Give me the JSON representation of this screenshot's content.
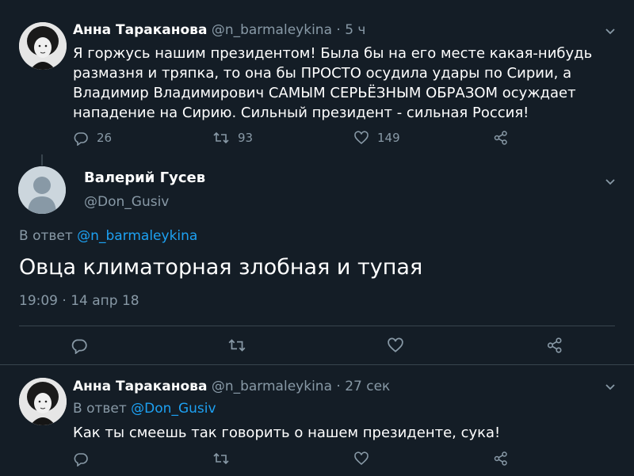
{
  "tweet1": {
    "author_name": "Анна Тараканова",
    "author_handle": "@n_barmaleykina",
    "time": "· 5 ч",
    "text": "Я горжусь нашим президентом! Была бы на его месте какая-нибудь размазня и тряпка, то она бы ПРОСТО осудила удары по Сирии, а Владимир Владимирович САМЫМ СЕРЬЁЗНЫМ ОБРАЗОМ осуждает нападение на Сирию. Сильный президент - сильная Россия!",
    "replies": "26",
    "retweets": "93",
    "likes": "149"
  },
  "tweet2": {
    "author_name": "Валерий Гусев",
    "author_handle": "@Don_Gusiv",
    "reply_prefix": "В ответ",
    "reply_mention": "@n_barmaleykina",
    "text": "Овца климаторная злобная и тупая",
    "timestamp": "19:09 · 14 апр 18"
  },
  "tweet3": {
    "author_name": "Анна Тараканова",
    "author_handle": "@n_barmaleykina",
    "time": "· 27 сек",
    "reply_prefix": "В ответ",
    "reply_mention": "@Don_Gusiv",
    "text": "Как ты смеешь так говорить о нашем президенте, сука!"
  },
  "icons": {
    "reply": "reply-icon",
    "retweet": "retweet-icon",
    "like": "heart-icon",
    "share": "share-icon",
    "more": "chevron-down-icon"
  },
  "colors": {
    "background": "#141d26",
    "muted": "#8899a6",
    "link": "#1da1f2",
    "divider": "#38444d"
  }
}
